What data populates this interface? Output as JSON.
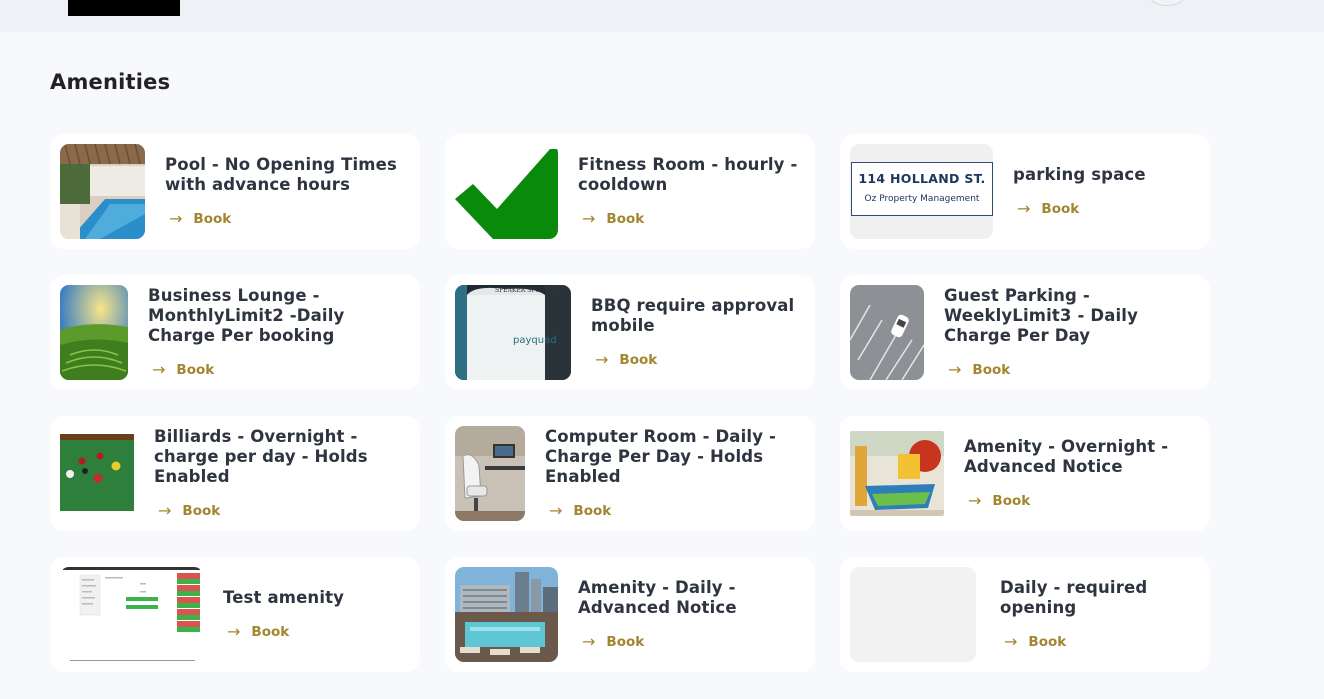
{
  "page": {
    "heading": "Amenities"
  },
  "colors": {
    "accent": "#a2852e",
    "background": "#f7f9fc",
    "card": "#ffffff"
  },
  "amenities": [
    {
      "title": "Pool - No Opening Times with advance hours",
      "book_label": "Book",
      "icon": "arrow-right-icon"
    },
    {
      "title": "Fitness Room - hourly - cooldown",
      "book_label": "Book",
      "icon": "arrow-right-icon"
    },
    {
      "title": "parking space",
      "book_label": "Book",
      "icon": "arrow-right-icon",
      "image_text": [
        "114 HOLLAND ST.",
        "Oz Property Management"
      ]
    },
    {
      "title": "Business Lounge - MonthlyLimit2 -Daily Charge Per booking",
      "book_label": "Book",
      "icon": "arrow-right-icon"
    },
    {
      "title": "BBQ require approval mobile",
      "book_label": "Book",
      "icon": "arrow-right-icon",
      "image_text": [
        "SPEAKER SPONSOR",
        "payquad"
      ]
    },
    {
      "title": "Guest Parking - WeeklyLimit3 - Daily Charge Per Day",
      "book_label": "Book",
      "icon": "arrow-right-icon"
    },
    {
      "title": "Billiards - Overnight - charge per day - Holds Enabled",
      "book_label": "Book",
      "icon": "arrow-right-icon"
    },
    {
      "title": "Computer Room - Daily - Charge Per Day - Holds Enabled",
      "book_label": "Book",
      "icon": "arrow-right-icon"
    },
    {
      "title": "Amenity - Overnight - Advanced Notice",
      "book_label": "Book",
      "icon": "arrow-right-icon"
    },
    {
      "title": "Test amenity",
      "book_label": "Book",
      "icon": "arrow-right-icon"
    },
    {
      "title": "Amenity - Daily - Advanced Notice",
      "book_label": "Book",
      "icon": "arrow-right-icon"
    },
    {
      "title": "Daily - required opening",
      "book_label": "Book",
      "icon": "arrow-right-icon"
    }
  ]
}
